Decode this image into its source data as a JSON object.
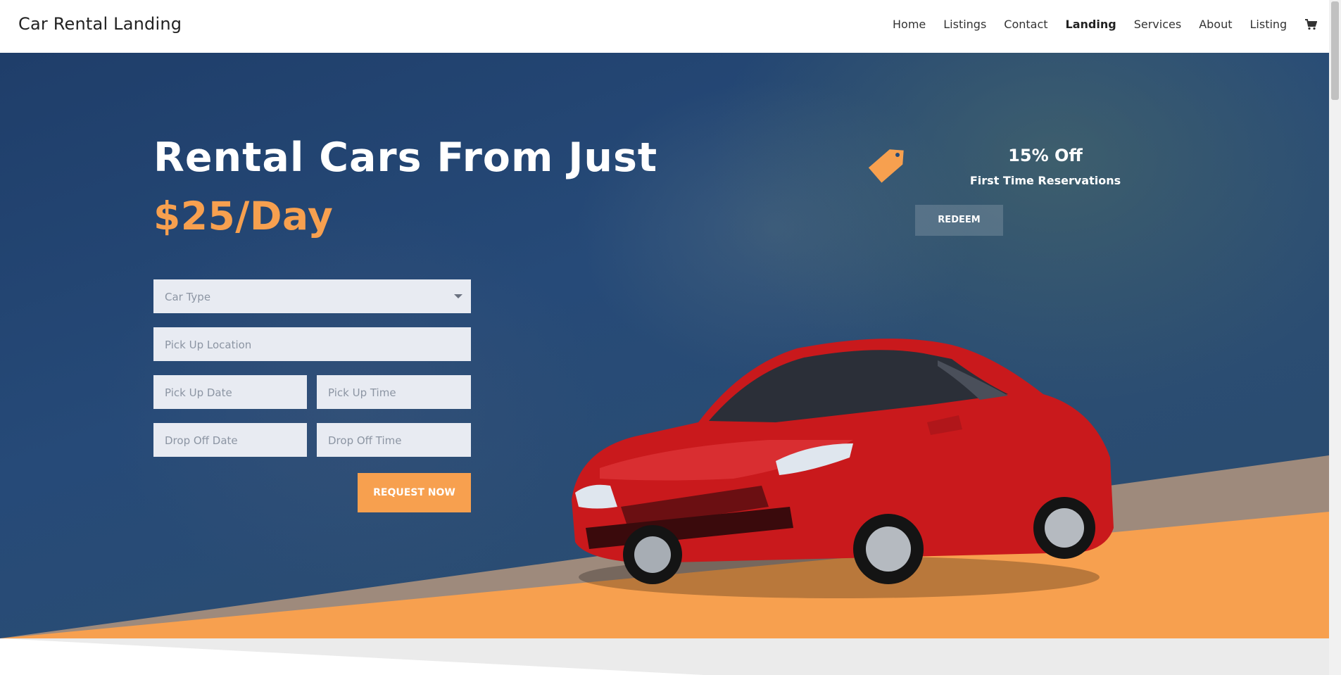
{
  "header": {
    "site_title": "Car Rental Landing",
    "nav": [
      {
        "label": "Home"
      },
      {
        "label": "Listings"
      },
      {
        "label": "Contact"
      },
      {
        "label": "Landing"
      },
      {
        "label": "Services"
      },
      {
        "label": "About"
      },
      {
        "label": "Listing"
      }
    ],
    "active_nav": "Landing",
    "cart_icon": "cart-icon"
  },
  "hero": {
    "headline": "Rental Cars From Just",
    "price": "$25/Day",
    "form": {
      "car_type_placeholder": "Car Type",
      "pickup_location_placeholder": "Pick Up Location",
      "pickup_date_placeholder": "Pick Up Date",
      "pickup_time_placeholder": "Pick Up Time",
      "dropoff_date_placeholder": "Drop Off Date",
      "dropoff_time_placeholder": "Drop Off Time",
      "submit_label": "REQUEST NOW"
    },
    "offer": {
      "title": "15% Off",
      "subtitle": "First Time Reservations",
      "button_label": "REDEEM",
      "icon": "price-tag-icon"
    }
  },
  "colors": {
    "accent": "#f7a04f",
    "hero_blue": "#264a78",
    "field_bg": "#e8ebf2"
  }
}
